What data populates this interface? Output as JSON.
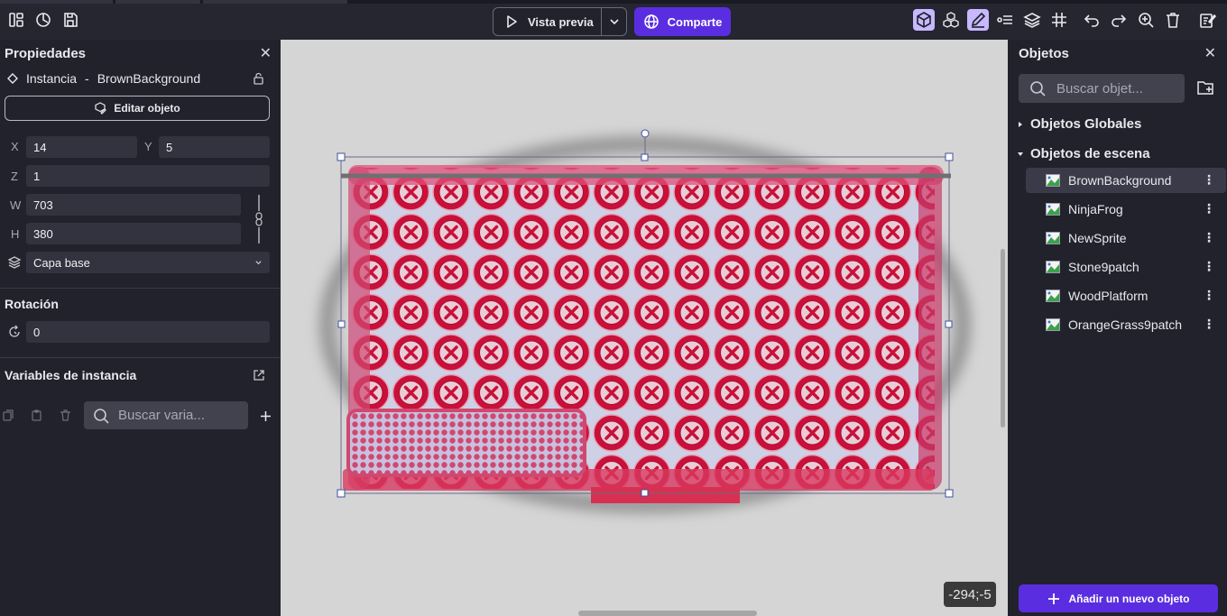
{
  "toolbar": {
    "preview_label": "Vista previa",
    "share_label": "Comparte"
  },
  "properties": {
    "title": "Propiedades",
    "instance_prefix": "Instancia",
    "instance_separator": "-",
    "instance_name": "BrownBackground",
    "edit_object_label": "Editar objeto",
    "x_label": "X",
    "x_value": "14",
    "y_label": "Y",
    "y_value": "5",
    "z_label": "Z",
    "z_value": "1",
    "w_label": "W",
    "w_value": "703",
    "h_label": "H",
    "h_value": "380",
    "layer_value": "Capa base",
    "rotation_title": "Rotación",
    "rotation_value": "0",
    "variables_title": "Variables de instancia",
    "variables_search_placeholder": "Buscar varia..."
  },
  "canvas": {
    "cursor_coords": "-294;-5"
  },
  "objects": {
    "title": "Objetos",
    "search_placeholder": "Buscar objet...",
    "global_group": "Objetos Globales",
    "scene_group": "Objetos de escena",
    "items": [
      {
        "label": "BrownBackground",
        "selected": true
      },
      {
        "label": "NinjaFrog"
      },
      {
        "label": "NewSprite"
      },
      {
        "label": "Stone9patch"
      },
      {
        "label": "WoodPlatform"
      },
      {
        "label": "OrangeGrass9patch"
      }
    ],
    "add_button_label": "Añadir un nuevo objeto"
  },
  "colors": {
    "accent": "#5a2ee0",
    "active_tool": "#c7b8ff",
    "canvas_bg": "#d5d5d5",
    "panel_bg": "#22222c"
  }
}
